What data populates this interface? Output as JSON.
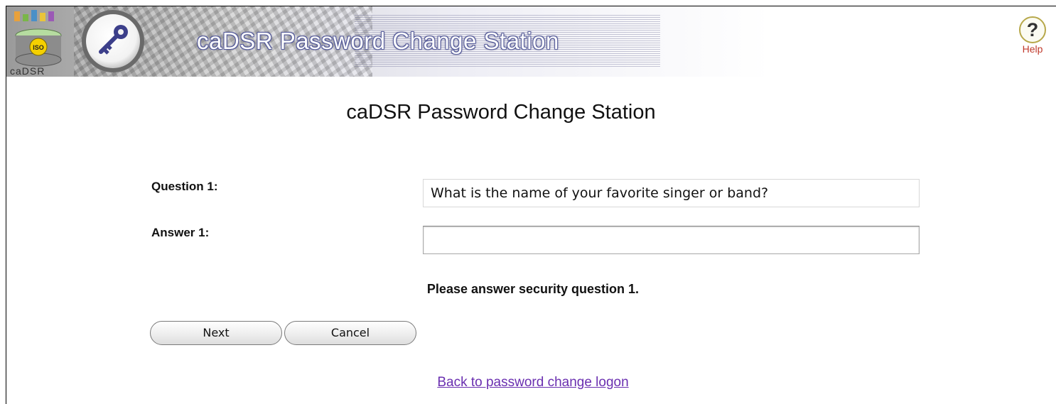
{
  "header": {
    "logo_text": "caDSR",
    "banner_title": "caDSR Password Change Station",
    "help_label": "Help"
  },
  "main": {
    "title": "caDSR Password Change Station",
    "question_label": "Question 1:",
    "question_value": "What is the name of your favorite singer or band?",
    "answer_label": "Answer 1:",
    "answer_value": "",
    "message": "Please answer security question 1.",
    "next_label": "Next",
    "cancel_label": "Cancel",
    "back_link": "Back to password change logon"
  },
  "colors": {
    "link": "#6a2fb0",
    "help_accent": "#c0392b"
  }
}
